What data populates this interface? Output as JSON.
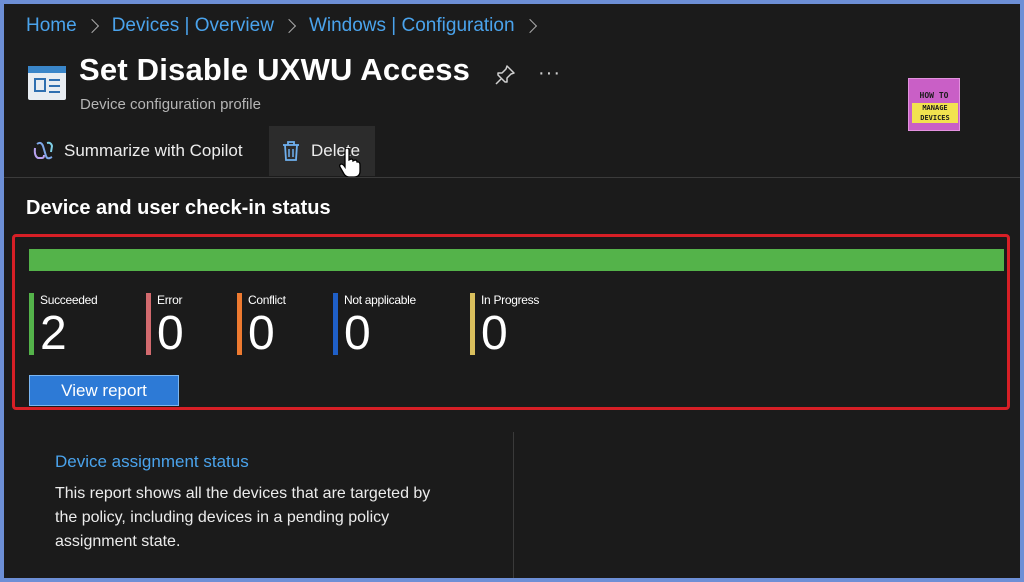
{
  "breadcrumb": [
    "Home",
    "Devices | Overview",
    "Windows | Configuration"
  ],
  "header": {
    "title": "Set Disable UXWU Access",
    "subtitle": "Device configuration profile",
    "more": "···"
  },
  "logo": {
    "line1": "HOW TO",
    "line2": "MANAGE DEVICES"
  },
  "toolbar": {
    "copilot_label": "Summarize with Copilot",
    "delete_label": "Delete"
  },
  "checkin": {
    "title": "Device and user check-in status",
    "progress_fraction": 1.0,
    "stats": [
      {
        "label": "Succeeded",
        "value": "2",
        "color": "#54b34a"
      },
      {
        "label": "Error",
        "value": "0",
        "color": "#d26a6e"
      },
      {
        "label": "Conflict",
        "value": "0",
        "color": "#ee7a30"
      },
      {
        "label": "Not applicable",
        "value": "0",
        "color": "#1f5fc7"
      },
      {
        "label": "In Progress",
        "value": "0",
        "color": "#d9bf5d"
      }
    ],
    "view_report_label": "View report"
  },
  "assignment_card": {
    "title": "Device assignment status",
    "body": "This report shows all the devices that are targeted by the policy, including devices in a pending policy assignment state."
  },
  "colors": {
    "accent": "#4aa3ec",
    "highlight_border": "#d71f26",
    "button": "#2d7ad6"
  }
}
